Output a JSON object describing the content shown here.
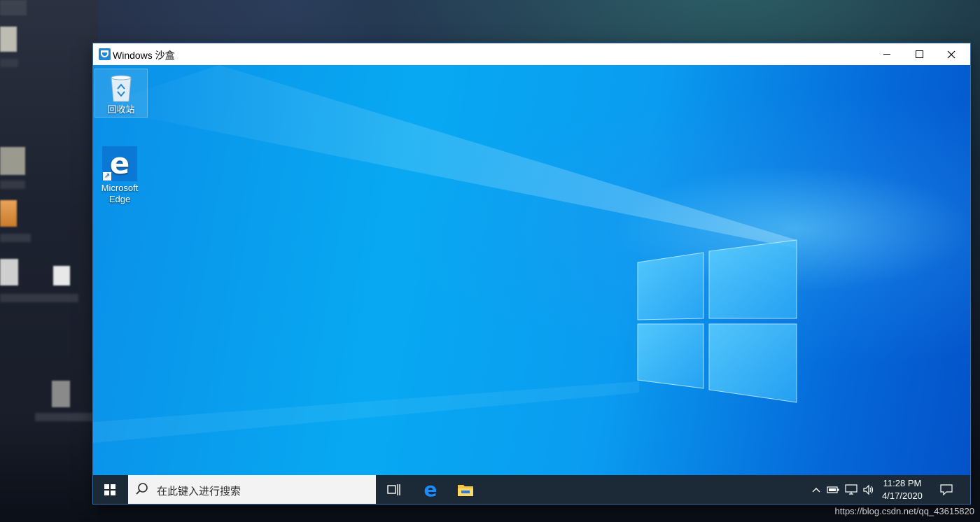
{
  "window": {
    "title": "Windows 沙盒"
  },
  "desktop": {
    "icons": [
      {
        "label": "回收站",
        "icon": "recycle-bin-icon"
      },
      {
        "label": "Microsoft Edge",
        "icon": "edge-icon"
      }
    ]
  },
  "taskbar": {
    "search_placeholder": "在此键入进行搜索",
    "pinned": [
      "task-view-icon",
      "edge-icon",
      "file-explorer-icon"
    ],
    "clock_time": "11:28 PM",
    "clock_date": "4/17/2020"
  },
  "watermark": "https://blog.csdn.net/qq_43615820",
  "colors": {
    "desktop_accent": "#0a9cf0",
    "taskbar_bg": "#1b2a36",
    "edge_blue": "#0a78d4"
  }
}
